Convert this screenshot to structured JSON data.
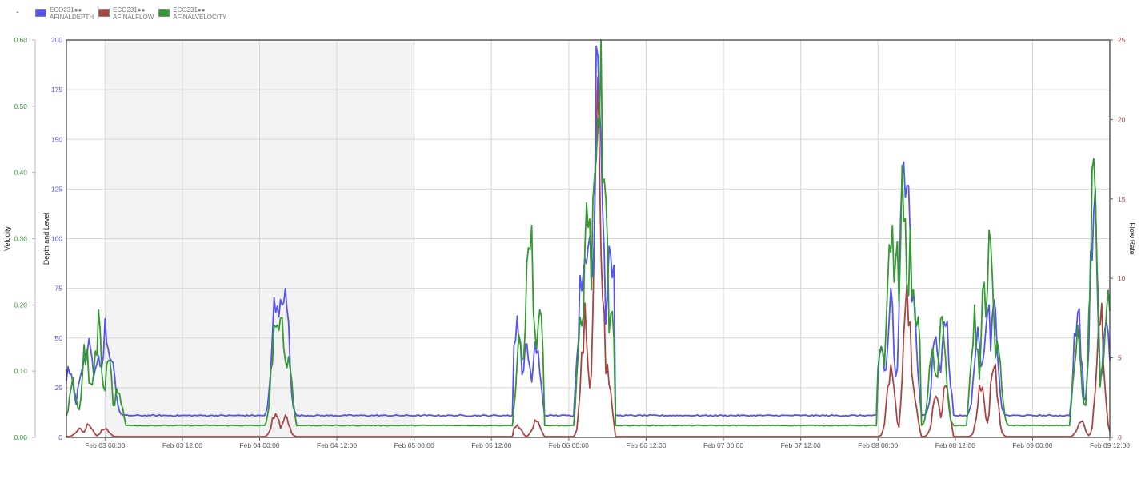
{
  "legend": {
    "leading_mark": "-",
    "items": [
      {
        "line1": "ECO231●●",
        "line2": "AFINALDEPTH",
        "color": "#5555ee"
      },
      {
        "line1": "ECO231●●",
        "line2": "AFINALFLOW",
        "color": "#aa4444"
      },
      {
        "line1": "ECO231●●",
        "line2": "AFINALVELOCITY",
        "color": "#339933"
      }
    ]
  },
  "chart_data": {
    "type": "line",
    "x_start": "Feb 02 18:00",
    "x_end": "Feb 09 12:00",
    "x_ticks": [
      "Feb 03 00:00",
      "Feb 03 12:00",
      "Feb 04 00:00",
      "Feb 04 12:00",
      "Feb 05 00:00",
      "Feb 05 12:00",
      "Feb 06 00:00",
      "Feb 06 12:00",
      "Feb 07 00:00",
      "Feb 07 12:00",
      "Feb 08 00:00",
      "Feb 08 12:00",
      "Feb 09 00:00",
      "Feb 09 12:00"
    ],
    "shaded_region": {
      "from": "Feb 03 00:00",
      "to": "Feb 05 00:00"
    },
    "grid": true,
    "axes": {
      "velocity": {
        "label": "Velocity",
        "range": [
          0,
          0.6
        ],
        "ticks": [
          "0.00",
          "0.10",
          "0.20",
          "0.30",
          "0.40",
          "0.50",
          "0.60"
        ],
        "color": "#339933",
        "side": "left-outer"
      },
      "depth": {
        "label": "Depth and Level",
        "range": [
          0,
          200
        ],
        "ticks": [
          "0",
          "25",
          "50",
          "75",
          "100",
          "125",
          "150",
          "175",
          "200"
        ],
        "color": "#5555ee",
        "side": "left-inner"
      },
      "flow": {
        "label": "Flow Rate",
        "range": [
          0,
          25
        ],
        "ticks": [
          "0",
          "5",
          "10",
          "15",
          "20",
          "25"
        ],
        "color": "#aa4444",
        "side": "right"
      }
    },
    "series": [
      {
        "name": "ECO231●● AFINALDEPTH",
        "axis": "depth",
        "color": "#5555ee",
        "baseline": 11,
        "events": [
          {
            "start": "Feb 02 18:00",
            "end": "Feb 03 03:00",
            "peaks": [
              [
                "Feb 02 18:30",
                25
              ],
              [
                "Feb 02 20:30",
                30
              ],
              [
                "Feb 02 21:30",
                47
              ],
              [
                "Feb 02 23:00",
                35
              ],
              [
                "Feb 03 00:00",
                44
              ],
              [
                "Feb 03 01:00",
                28
              ]
            ]
          },
          {
            "start": "Feb 04 01:00",
            "end": "Feb 04 05:30",
            "peaks": [
              [
                "Feb 04 02:30",
                69
              ],
              [
                "Feb 04 03:30",
                60
              ],
              [
                "Feb 04 04:00",
                65
              ]
            ]
          },
          {
            "start": "Feb 05 15:30",
            "end": "Feb 05 20:00",
            "peaks": [
              [
                "Feb 05 16:00",
                52
              ],
              [
                "Feb 05 17:30",
                36
              ],
              [
                "Feb 05 19:00",
                38
              ]
            ]
          },
          {
            "start": "Feb 06 01:00",
            "end": "Feb 06 07:00",
            "peaks": [
              [
                "Feb 06 02:00",
                75
              ],
              [
                "Feb 06 03:00",
                112
              ],
              [
                "Feb 06 04:30",
                188
              ],
              [
                "Feb 06 05:00",
                140
              ],
              [
                "Feb 06 06:30",
                100
              ]
            ]
          },
          {
            "start": "Feb 08 00:00",
            "end": "Feb 08 06:30",
            "peaks": [
              [
                "Feb 08 00:30",
                35
              ],
              [
                "Feb 08 02:00",
                60
              ],
              [
                "Feb 08 04:00",
                142
              ],
              [
                "Feb 08 04:30",
                120
              ],
              [
                "Feb 08 05:30",
                60
              ]
            ]
          },
          {
            "start": "Feb 08 07:00",
            "end": "Feb 08 11:30",
            "peaks": [
              [
                "Feb 08 09:00",
                45
              ],
              [
                "Feb 08 10:30",
                50
              ]
            ]
          },
          {
            "start": "Feb 08 14:00",
            "end": "Feb 08 20:00",
            "peaks": [
              [
                "Feb 08 15:30",
                40
              ],
              [
                "Feb 08 17:00",
                60
              ],
              [
                "Feb 08 18:00",
                55
              ]
            ]
          },
          {
            "start": "Feb 09 06:00",
            "end": "Feb 09 12:00",
            "peaks": [
              [
                "Feb 09 07:00",
                55
              ],
              [
                "Feb 09 09:30",
                115
              ],
              [
                "Feb 09 11:30",
                48
              ]
            ]
          }
        ]
      },
      {
        "name": "ECO231●● AFINALFLOW",
        "axis": "flow",
        "color": "#aa4444",
        "baseline": 0.05,
        "events": [
          {
            "start": "Feb 02 18:00",
            "end": "Feb 03 03:00",
            "peaks": [
              [
                "Feb 02 20:00",
                0.5
              ],
              [
                "Feb 02 21:30",
                0.8
              ],
              [
                "Feb 03 00:00",
                0.6
              ]
            ]
          },
          {
            "start": "Feb 04 01:00",
            "end": "Feb 04 05:30",
            "peaks": [
              [
                "Feb 04 02:30",
                1.6
              ],
              [
                "Feb 04 04:00",
                1.3
              ]
            ]
          },
          {
            "start": "Feb 05 15:30",
            "end": "Feb 05 20:00",
            "peaks": [
              [
                "Feb 05 16:00",
                0.8
              ],
              [
                "Feb 05 19:00",
                1.2
              ]
            ]
          },
          {
            "start": "Feb 06 01:00",
            "end": "Feb 06 07:00",
            "peaks": [
              [
                "Feb 06 02:30",
                7.5
              ],
              [
                "Feb 06 03:30",
                3.8
              ],
              [
                "Feb 06 04:30",
                21.5
              ],
              [
                "Feb 06 05:00",
                11
              ],
              [
                "Feb 06 06:00",
                4
              ]
            ]
          },
          {
            "start": "Feb 08 00:00",
            "end": "Feb 08 06:30",
            "peaks": [
              [
                "Feb 08 02:00",
                4.5
              ],
              [
                "Feb 08 04:30",
                10
              ],
              [
                "Feb 08 05:30",
                3
              ]
            ]
          },
          {
            "start": "Feb 08 07:00",
            "end": "Feb 08 11:30",
            "peaks": [
              [
                "Feb 08 09:00",
                2.5
              ],
              [
                "Feb 08 10:30",
                3
              ]
            ]
          },
          {
            "start": "Feb 08 14:00",
            "end": "Feb 08 20:00",
            "peaks": [
              [
                "Feb 08 16:00",
                3.5
              ],
              [
                "Feb 08 18:00",
                4.5
              ]
            ]
          },
          {
            "start": "Feb 09 06:00",
            "end": "Feb 09 12:00",
            "peaks": [
              [
                "Feb 09 07:30",
                1
              ],
              [
                "Feb 09 10:30",
                8.5
              ],
              [
                "Feb 09 11:30",
                0.6
              ]
            ]
          }
        ]
      },
      {
        "name": "ECO231●● AFINALVELOCITY",
        "axis": "velocity",
        "color": "#339933",
        "baseline": 0.018,
        "events": [
          {
            "start": "Feb 02 18:00",
            "end": "Feb 03 03:00",
            "peaks": [
              [
                "Feb 02 19:00",
                0.07
              ],
              [
                "Feb 02 21:00",
                0.12
              ],
              [
                "Feb 02 22:00",
                0.08
              ],
              [
                "Feb 02 23:00",
                0.155
              ],
              [
                "Feb 03 00:30",
                0.1
              ],
              [
                "Feb 03 02:00",
                0.06
              ]
            ]
          },
          {
            "start": "Feb 04 01:00",
            "end": "Feb 04 05:30",
            "peaks": [
              [
                "Feb 04 02:30",
                0.19
              ],
              [
                "Feb 04 03:30",
                0.17
              ],
              [
                "Feb 04 04:30",
                0.1
              ]
            ]
          },
          {
            "start": "Feb 05 15:30",
            "end": "Feb 05 20:00",
            "peaks": [
              [
                "Feb 05 16:30",
                0.14
              ],
              [
                "Feb 05 18:00",
                0.34
              ],
              [
                "Feb 05 19:30",
                0.16
              ]
            ]
          },
          {
            "start": "Feb 06 01:00",
            "end": "Feb 06 07:00",
            "peaks": [
              [
                "Feb 06 02:00",
                0.2
              ],
              [
                "Feb 06 03:00",
                0.38
              ],
              [
                "Feb 06 04:00",
                0.36
              ],
              [
                "Feb 06 04:45",
                0.585
              ],
              [
                "Feb 06 05:30",
                0.37
              ],
              [
                "Feb 06 06:30",
                0.2
              ]
            ]
          },
          {
            "start": "Feb 08 00:00",
            "end": "Feb 08 06:30",
            "peaks": [
              [
                "Feb 08 00:30",
                0.12
              ],
              [
                "Feb 08 02:00",
                0.34
              ],
              [
                "Feb 08 03:00",
                0.26
              ],
              [
                "Feb 08 04:00",
                0.41
              ],
              [
                "Feb 08 05:00",
                0.27
              ],
              [
                "Feb 08 06:00",
                0.17
              ]
            ]
          },
          {
            "start": "Feb 08 07:00",
            "end": "Feb 08 11:30",
            "peaks": [
              [
                "Feb 08 08:30",
                0.12
              ],
              [
                "Feb 08 10:00",
                0.17
              ]
            ]
          },
          {
            "start": "Feb 08 14:00",
            "end": "Feb 08 20:00",
            "peaks": [
              [
                "Feb 08 15:00",
                0.16
              ],
              [
                "Feb 08 16:30",
                0.2
              ],
              [
                "Feb 08 17:30",
                0.29
              ],
              [
                "Feb 08 18:30",
                0.15
              ]
            ]
          },
          {
            "start": "Feb 09 06:00",
            "end": "Feb 09 12:00",
            "peaks": [
              [
                "Feb 09 07:00",
                0.15
              ],
              [
                "Feb 09 09:30",
                0.4
              ],
              [
                "Feb 09 11:00",
                0.1
              ],
              [
                "Feb 09 11:45",
                0.19
              ]
            ]
          }
        ]
      }
    ]
  }
}
